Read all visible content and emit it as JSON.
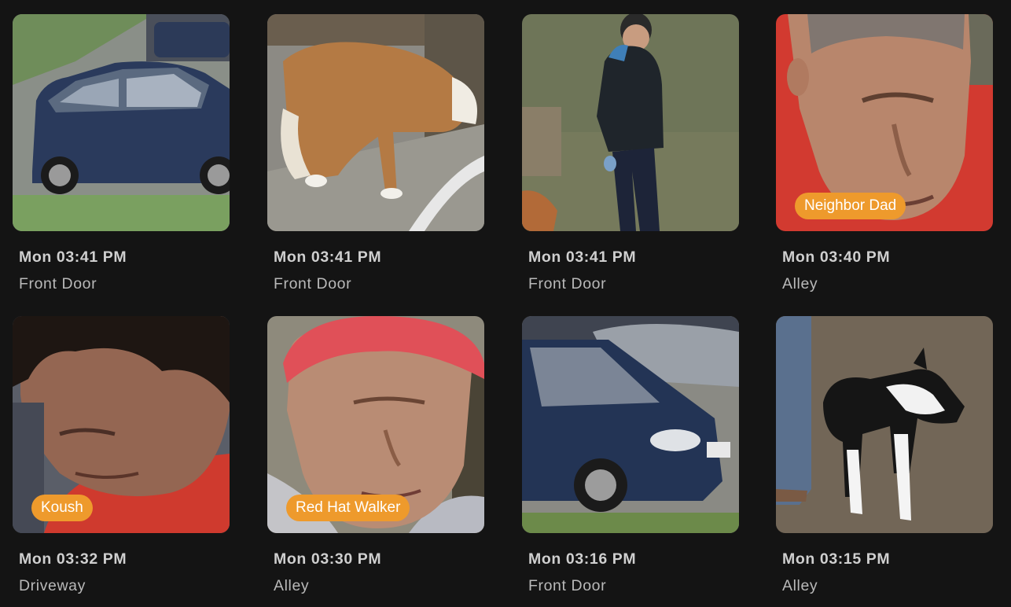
{
  "events": [
    {
      "time": "Mon 03:41 PM",
      "location": "Front Door",
      "label": "",
      "subject": "car"
    },
    {
      "time": "Mon 03:41 PM",
      "location": "Front Door",
      "label": "",
      "subject": "dog"
    },
    {
      "time": "Mon 03:41 PM",
      "location": "Front Door",
      "label": "",
      "subject": "person"
    },
    {
      "time": "Mon 03:40 PM",
      "location": "Alley",
      "label": "Neighbor Dad",
      "subject": "face"
    },
    {
      "time": "Mon 03:32 PM",
      "location": "Driveway",
      "label": "Koush",
      "subject": "face"
    },
    {
      "time": "Mon 03:30 PM",
      "location": "Alley",
      "label": "Red Hat Walker",
      "subject": "face"
    },
    {
      "time": "Mon 03:16 PM",
      "location": "Front Door",
      "label": "",
      "subject": "car"
    },
    {
      "time": "Mon 03:15 PM",
      "location": "Alley",
      "label": "",
      "subject": "dog"
    }
  ],
  "colors": {
    "background": "#141414",
    "badge": "#ee9a2c",
    "badge_text": "#ffffff"
  }
}
